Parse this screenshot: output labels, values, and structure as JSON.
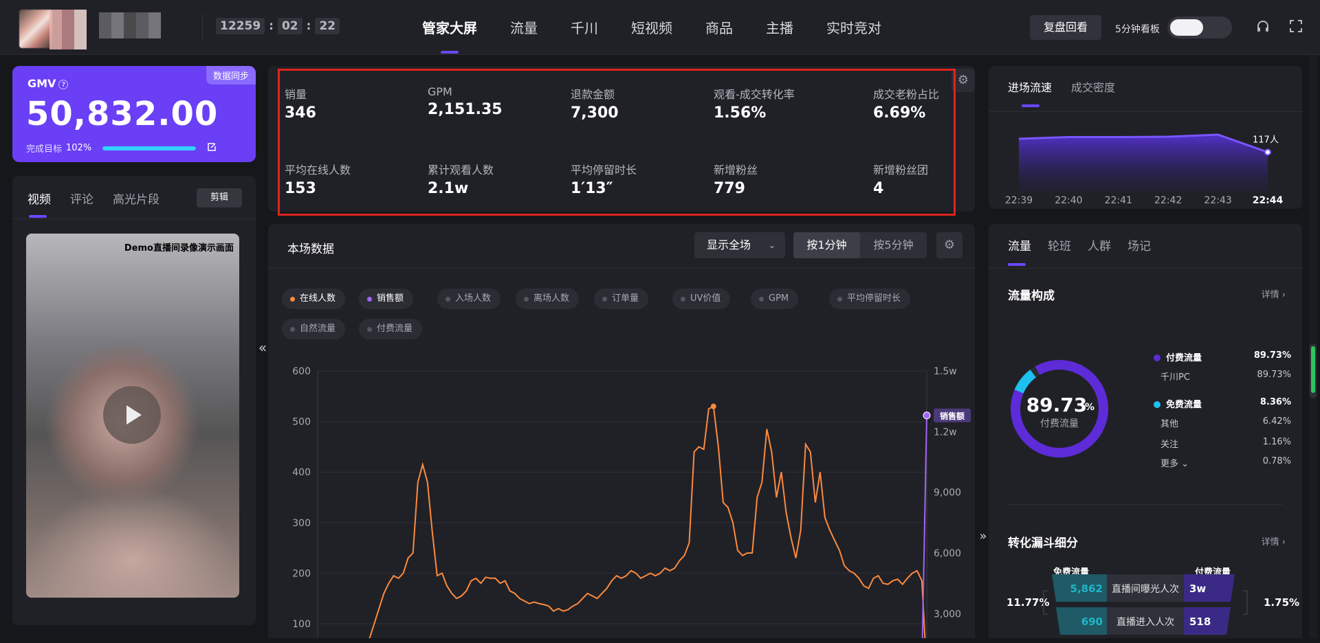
{
  "topbar": {
    "timer": {
      "hours": "12259",
      "minutes": "02",
      "seconds": "22"
    },
    "nav": [
      "管家大屏",
      "流量",
      "千川",
      "短视频",
      "商品",
      "主播",
      "实时竞对"
    ],
    "replay_label": "复盘回看",
    "toggle_label": "5分钟看板",
    "icons": [
      "headset-icon",
      "fullscreen-icon"
    ]
  },
  "gmv": {
    "label": "GMV",
    "sync": "数据同步",
    "value": "50,832.00",
    "target_label": "完成目标",
    "target_pct": "102%",
    "target_fill": 1.0
  },
  "video": {
    "tabs": [
      "视频",
      "评论",
      "高光片段"
    ],
    "clip_label": "剪辑",
    "caption": "Demo直播间录像演示画面"
  },
  "metrics": [
    {
      "label": "销量",
      "value": "346"
    },
    {
      "label": "GPM",
      "value": "2,151.35"
    },
    {
      "label": "退款金额",
      "value": "7,300"
    },
    {
      "label": "观看-成交转化率",
      "value": "1.56%"
    },
    {
      "label": "成交老粉占比",
      "value": "6.69%"
    },
    {
      "label": "平均在线人数",
      "value": "153"
    },
    {
      "label": "累计观看人数",
      "value": "2.1w"
    },
    {
      "label": "平均停留时长",
      "value": "1′13″"
    },
    {
      "label": "新增粉丝",
      "value": "779"
    },
    {
      "label": "新增粉丝团",
      "value": "4"
    }
  ],
  "data_panel": {
    "title": "本场数据",
    "select": "显示全场",
    "seg": [
      "按1分钟",
      "按5分钟"
    ],
    "chips": [
      "在线人数",
      "销售额",
      "入场人数",
      "离场人数",
      "订单量",
      "UV价值",
      "GPM",
      "平均停留时长",
      "自然流量",
      "付费流量"
    ],
    "chips_on": [
      "在线人数",
      "销售额"
    ],
    "colors": {
      "online": "#ff8a3d",
      "sales": "#a463f7"
    }
  },
  "chart_data": [
    {
      "type": "line",
      "title": "",
      "y_left_ticks": [
        "600",
        "500",
        "400",
        "300",
        "200",
        "100"
      ],
      "y_right_ticks": [
        "1.5w",
        "1.2w",
        "9,000",
        "6,000",
        "3,000"
      ],
      "ylim_left": [
        0,
        600
      ],
      "ylim_right": [
        0,
        15000
      ],
      "series": [
        {
          "name": "在线人数",
          "axis": "left",
          "values": [
            0,
            10,
            20,
            35,
            50,
            70,
            100,
            130,
            160,
            180,
            195,
            190,
            200,
            230,
            240,
            380,
            415,
            380,
            280,
            195,
            200,
            175,
            160,
            150,
            155,
            165,
            185,
            190,
            180,
            192,
            190,
            190,
            180,
            185,
            165,
            160,
            150,
            145,
            140,
            143,
            140,
            138,
            135,
            125,
            130,
            125,
            128,
            135,
            140,
            150,
            160,
            155,
            150,
            160,
            170,
            185,
            195,
            190,
            195,
            205,
            200,
            190,
            195,
            200,
            195,
            200,
            210,
            205,
            210,
            225,
            235,
            260,
            440,
            450,
            445,
            525,
            530,
            450,
            340,
            330,
            300,
            245,
            235,
            240,
            240,
            350,
            380,
            485,
            440,
            350,
            400,
            320,
            270,
            230,
            285,
            455,
            440,
            340,
            400,
            310,
            285,
            265,
            245,
            215,
            205,
            200,
            190,
            175,
            170,
            190,
            195,
            180,
            178,
            185,
            188,
            178,
            190,
            200,
            205,
            185,
            5
          ]
        },
        {
          "name": "销售额",
          "axis": "right",
          "label": "销售额",
          "points": [
            {
              "x": 68,
              "y": 0
            },
            {
              "x": 119,
              "y": 0
            },
            {
              "x": 120,
              "y": 12800
            }
          ],
          "note": "spike near chart end"
        }
      ]
    },
    {
      "type": "area",
      "title": "进场流速",
      "categories": [
        "22:39",
        "22:40",
        "22:41",
        "22:42",
        "22:43",
        "22:44"
      ],
      "values": [
        156,
        161,
        161,
        162,
        168,
        117
      ],
      "last_label": "117人"
    },
    {
      "type": "pie",
      "title": "流量构成",
      "center_value": "89.73",
      "center_unit": "%",
      "center_label": "付费流量",
      "slices": [
        {
          "name": "付费流量",
          "value": 89.73,
          "color": "#5e2bd8"
        },
        {
          "name": "免费流量",
          "value": 8.36,
          "color": "#1ec0f0"
        }
      ]
    }
  ],
  "flow_top": {
    "tabs": [
      "进场流速",
      "成交密度"
    ]
  },
  "flow_panel": {
    "tabs": [
      "流量",
      "轮班",
      "人群",
      "场记"
    ],
    "composition_title": "流量构成",
    "detail": "详情",
    "legend": [
      {
        "name": "付费流量",
        "pct": "89.73%",
        "major": true,
        "color": "#5e2bd8"
      },
      {
        "name": "千川PC",
        "pct": "89.73%",
        "major": false
      },
      {
        "name": "免费流量",
        "pct": "8.36%",
        "major": true,
        "color": "#1ec0f0"
      },
      {
        "name": "其他",
        "pct": "6.42%",
        "major": false
      },
      {
        "name": "关注",
        "pct": "1.16%",
        "major": false
      },
      {
        "name": "更多",
        "pct": "0.78%",
        "major": false
      }
    ],
    "funnel_title": "转化漏斗细分",
    "funnel": {
      "free_label": "免费流量",
      "paid_label": "付费流量",
      "left_pct": "11.77%",
      "right_pct": "1.75%",
      "rows": [
        {
          "label": "直播间曝光人次",
          "free": "5,862",
          "paid": "3w"
        },
        {
          "label": "直播进入人次",
          "free": "690",
          "paid": "518"
        }
      ]
    }
  }
}
